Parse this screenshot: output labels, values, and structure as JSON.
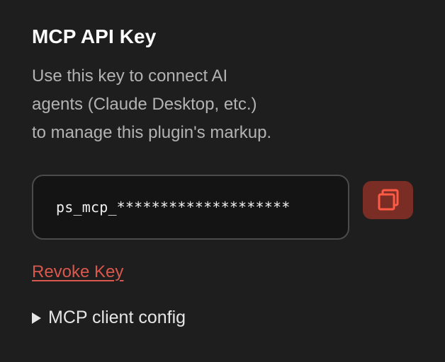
{
  "section": {
    "title": "MCP API Key",
    "description_lines": [
      "Use this key to connect AI",
      "agents (Claude Desktop, etc.)",
      "to manage this plugin's markup."
    ]
  },
  "api_key": {
    "masked_value": "ps_mcp_********************"
  },
  "actions": {
    "copy_icon": "copy-icon",
    "revoke_label": "Revoke Key"
  },
  "config": {
    "toggle_label": "MCP client config",
    "icon": "disclosure-triangle-icon",
    "expanded": false
  },
  "colors": {
    "background": "#1e1e1e",
    "field_background": "#141414",
    "field_border": "#4b4b4b",
    "copy_button": "#7a2d24",
    "copy_icon": "#ff5a45",
    "revoke_link": "#d9574d",
    "muted_text": "#b3b3b3"
  }
}
